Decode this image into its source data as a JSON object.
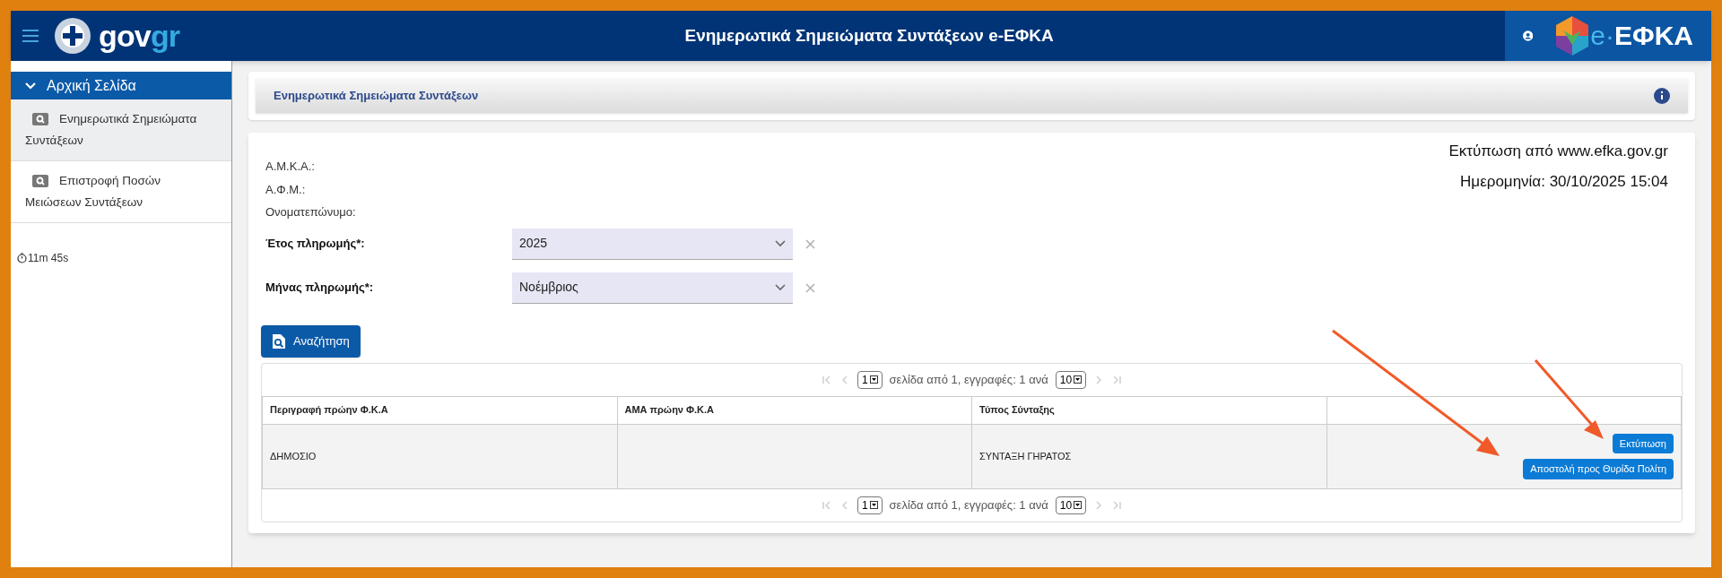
{
  "header": {
    "logo": {
      "gov": "gov",
      "gr": "gr"
    },
    "title": "Ενημερωτικά Σημειώματα Συντάξεων e-ΕΦΚΑ",
    "brand": {
      "prefix": "e·",
      "name": "ΕΦΚΑ"
    }
  },
  "sidebar": {
    "section": {
      "label": "Αρχική Σελίδα",
      "expanded": true
    },
    "items": [
      {
        "label": "Ενημερωτικά Σημειώματα Συντάξεων",
        "selected": true
      },
      {
        "label": "Επιστροφή Ποσών Μειώσεων Συντάξεων",
        "selected": false
      }
    ],
    "timer": "11m 45s"
  },
  "panel": {
    "title": "Ενημερωτικά Σημειώματα Συντάξεων"
  },
  "print_info": [
    "Εκτύπωση από www.efka.gov.gr",
    "Ημερομηνία: 30/10/2025 15:04"
  ],
  "info_labels": [
    "Α.Μ.Κ.Α.:",
    "Α.Φ.Μ.:",
    "Ονοματεπώνυμο:"
  ],
  "fields": [
    {
      "label": "Έτος πληρωμής*:",
      "value": "2025"
    },
    {
      "label": "Μήνας πληρωμής*:",
      "value": "Νοέμβριος"
    }
  ],
  "search_button": "Αναζήτηση",
  "pager_top": {
    "page": "1",
    "text": "σελίδα από 1, εγγραφές: 1 ανά",
    "per_page": "10"
  },
  "table": {
    "columns": [
      "Περιγραφή πρώην Φ.Κ.Α",
      "ΑΜΑ πρώην Φ.Κ.Α",
      "Τύπος Σύνταξης"
    ],
    "rows": [
      {
        "cells": [
          "ΔΗΜΟΣΙΟ",
          "",
          "ΣΥΝΤΑΞΗ ΓΗΡΑΤΟΣ"
        ],
        "actions": [
          "Εκτύπωση",
          "Αποστολή προς Θυρίδα Πολίτη"
        ]
      }
    ]
  },
  "pager_bottom": {
    "page": "1",
    "text": "σελίδα από 1, εγγραφές: 1 ανά",
    "per_page": "10"
  }
}
